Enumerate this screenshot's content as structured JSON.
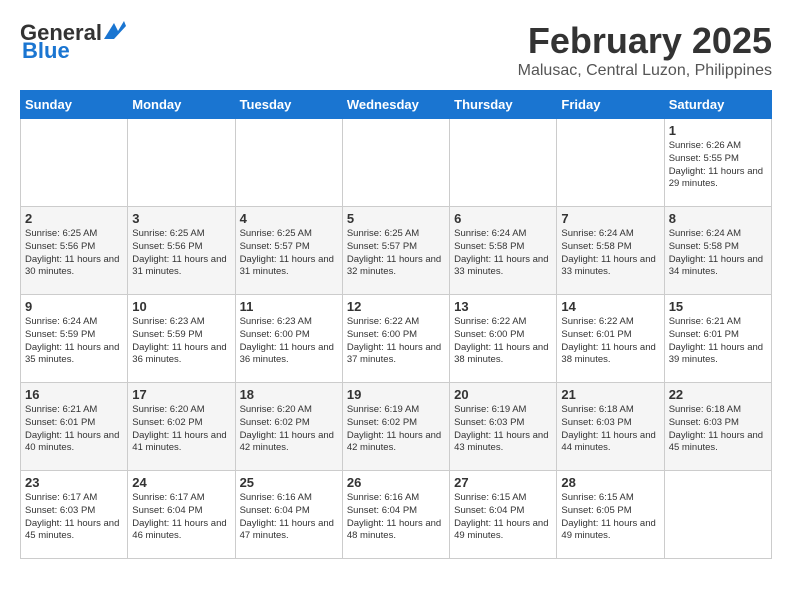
{
  "header": {
    "logo_general": "General",
    "logo_blue": "Blue",
    "month": "February 2025",
    "location": "Malusac, Central Luzon, Philippines"
  },
  "days_of_week": [
    "Sunday",
    "Monday",
    "Tuesday",
    "Wednesday",
    "Thursday",
    "Friday",
    "Saturday"
  ],
  "weeks": [
    [
      {
        "day": "",
        "info": ""
      },
      {
        "day": "",
        "info": ""
      },
      {
        "day": "",
        "info": ""
      },
      {
        "day": "",
        "info": ""
      },
      {
        "day": "",
        "info": ""
      },
      {
        "day": "",
        "info": ""
      },
      {
        "day": "1",
        "info": "Sunrise: 6:26 AM\nSunset: 5:55 PM\nDaylight: 11 hours\nand 29 minutes."
      }
    ],
    [
      {
        "day": "2",
        "info": "Sunrise: 6:25 AM\nSunset: 5:56 PM\nDaylight: 11 hours\nand 30 minutes."
      },
      {
        "day": "3",
        "info": "Sunrise: 6:25 AM\nSunset: 5:56 PM\nDaylight: 11 hours\nand 31 minutes."
      },
      {
        "day": "4",
        "info": "Sunrise: 6:25 AM\nSunset: 5:57 PM\nDaylight: 11 hours\nand 31 minutes."
      },
      {
        "day": "5",
        "info": "Sunrise: 6:25 AM\nSunset: 5:57 PM\nDaylight: 11 hours\nand 32 minutes."
      },
      {
        "day": "6",
        "info": "Sunrise: 6:24 AM\nSunset: 5:58 PM\nDaylight: 11 hours\nand 33 minutes."
      },
      {
        "day": "7",
        "info": "Sunrise: 6:24 AM\nSunset: 5:58 PM\nDaylight: 11 hours\nand 33 minutes."
      },
      {
        "day": "8",
        "info": "Sunrise: 6:24 AM\nSunset: 5:58 PM\nDaylight: 11 hours\nand 34 minutes."
      }
    ],
    [
      {
        "day": "9",
        "info": "Sunrise: 6:24 AM\nSunset: 5:59 PM\nDaylight: 11 hours\nand 35 minutes."
      },
      {
        "day": "10",
        "info": "Sunrise: 6:23 AM\nSunset: 5:59 PM\nDaylight: 11 hours\nand 36 minutes."
      },
      {
        "day": "11",
        "info": "Sunrise: 6:23 AM\nSunset: 6:00 PM\nDaylight: 11 hours\nand 36 minutes."
      },
      {
        "day": "12",
        "info": "Sunrise: 6:22 AM\nSunset: 6:00 PM\nDaylight: 11 hours\nand 37 minutes."
      },
      {
        "day": "13",
        "info": "Sunrise: 6:22 AM\nSunset: 6:00 PM\nDaylight: 11 hours\nand 38 minutes."
      },
      {
        "day": "14",
        "info": "Sunrise: 6:22 AM\nSunset: 6:01 PM\nDaylight: 11 hours\nand 38 minutes."
      },
      {
        "day": "15",
        "info": "Sunrise: 6:21 AM\nSunset: 6:01 PM\nDaylight: 11 hours\nand 39 minutes."
      }
    ],
    [
      {
        "day": "16",
        "info": "Sunrise: 6:21 AM\nSunset: 6:01 PM\nDaylight: 11 hours\nand 40 minutes."
      },
      {
        "day": "17",
        "info": "Sunrise: 6:20 AM\nSunset: 6:02 PM\nDaylight: 11 hours\nand 41 minutes."
      },
      {
        "day": "18",
        "info": "Sunrise: 6:20 AM\nSunset: 6:02 PM\nDaylight: 11 hours\nand 42 minutes."
      },
      {
        "day": "19",
        "info": "Sunrise: 6:19 AM\nSunset: 6:02 PM\nDaylight: 11 hours\nand 42 minutes."
      },
      {
        "day": "20",
        "info": "Sunrise: 6:19 AM\nSunset: 6:03 PM\nDaylight: 11 hours\nand 43 minutes."
      },
      {
        "day": "21",
        "info": "Sunrise: 6:18 AM\nSunset: 6:03 PM\nDaylight: 11 hours\nand 44 minutes."
      },
      {
        "day": "22",
        "info": "Sunrise: 6:18 AM\nSunset: 6:03 PM\nDaylight: 11 hours\nand 45 minutes."
      }
    ],
    [
      {
        "day": "23",
        "info": "Sunrise: 6:17 AM\nSunset: 6:03 PM\nDaylight: 11 hours\nand 45 minutes."
      },
      {
        "day": "24",
        "info": "Sunrise: 6:17 AM\nSunset: 6:04 PM\nDaylight: 11 hours\nand 46 minutes."
      },
      {
        "day": "25",
        "info": "Sunrise: 6:16 AM\nSunset: 6:04 PM\nDaylight: 11 hours\nand 47 minutes."
      },
      {
        "day": "26",
        "info": "Sunrise: 6:16 AM\nSunset: 6:04 PM\nDaylight: 11 hours\nand 48 minutes."
      },
      {
        "day": "27",
        "info": "Sunrise: 6:15 AM\nSunset: 6:04 PM\nDaylight: 11 hours\nand 49 minutes."
      },
      {
        "day": "28",
        "info": "Sunrise: 6:15 AM\nSunset: 6:05 PM\nDaylight: 11 hours\nand 49 minutes."
      },
      {
        "day": "",
        "info": ""
      }
    ]
  ]
}
